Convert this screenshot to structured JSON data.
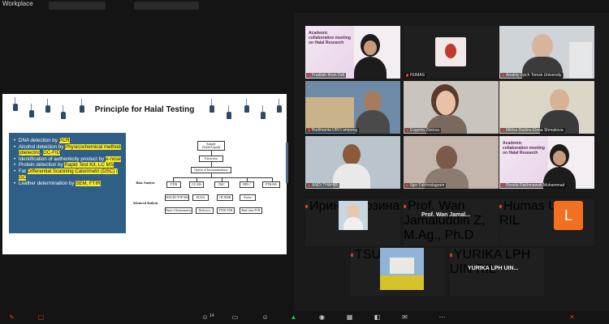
{
  "topbar": {
    "workspace": "Workplace"
  },
  "slide": {
    "title": "Principle for Halal Testing",
    "bullets": [
      {
        "before": "DNA detection by ",
        "hl": "PCR",
        "after": ""
      },
      {
        "before": "Alcohol detection by ",
        "hl": "Physicochemical method (dielectric",
        "after": ", ",
        "hl2": "GC-FID"
      },
      {
        "before": "Identification of authenticity product by ",
        "hl": "e-nose",
        "after": ""
      },
      {
        "before": "Protein detection by ",
        "hl": "Rapid Test Kit, LC MS",
        "after": ""
      },
      {
        "before": "Fat ",
        "hl": "Differential Scanning Calorimetri (DSC) / GC",
        "after": ""
      },
      {
        "before": "Leather determination by ",
        "hl": "SEM, FTIR",
        "after": ""
      }
    ],
    "diagram": {
      "sample": "Sample (Solid/Liquid)",
      "extraction": "Extraction",
      "options": "Option of Instrumentations",
      "basic": "Basic Analysis",
      "advanced": "Advanced Analysis",
      "ftir": "FTIR",
      "gcms": "GC-MS",
      "dsc": "DSC",
      "hplc": "HPLC",
      "ptrms": "PTR-MS",
      "maldi": "MALDI-TOF-MS",
      "elisa": "ELISA",
      "nmr": "1H NMR",
      "enose": "Enose",
      "basic_chemo": "Basic+Chemometrix",
      "dielectric": "Dielectric",
      "ftiratr": "FTIR-ATR",
      "rtpcr": "Real-time PCR"
    }
  },
  "participants": [
    {
      "id": "p1",
      "name": "Fradilah Ifrian Dzil",
      "banner": "Academic collaboration meeting on Halal Research"
    },
    {
      "id": "p2",
      "name": "HUMAS"
    },
    {
      "id": "p3",
      "name": "Anatoly Ilyich Tomsk University"
    },
    {
      "id": "p4",
      "name": "Budimanta UIN Lampung"
    },
    {
      "id": "p5",
      "name": "Evgenia Zlotova"
    },
    {
      "id": "p6",
      "name": "Militsa Radina Elena Shmakova"
    },
    {
      "id": "p7",
      "name": "ANDI THAHIR"
    },
    {
      "id": "p8",
      "name": "Ilgin Fakhrislagram"
    },
    {
      "id": "p9",
      "name": "Rosida Rakhmawati Muhammad",
      "banner": "Academic collaboration meeting on Halal Research"
    },
    {
      "id": "p10",
      "name": "Ирина Курзина"
    },
    {
      "id": "p11",
      "name": "Prof. Wan Jamaluddin Z, M.Ag., Ph.D",
      "big": "Prof. Wan Jamal..."
    },
    {
      "id": "p12",
      "name": "Humas UIN RIL",
      "initial": "L"
    },
    {
      "id": "p13",
      "name": "TSU ... ..."
    },
    {
      "id": "p14",
      "name": "YURIKA LPH UIN RIL",
      "big": "YURIKA LPH UIN..."
    }
  ],
  "bottombar": {
    "participants_count": "14"
  }
}
